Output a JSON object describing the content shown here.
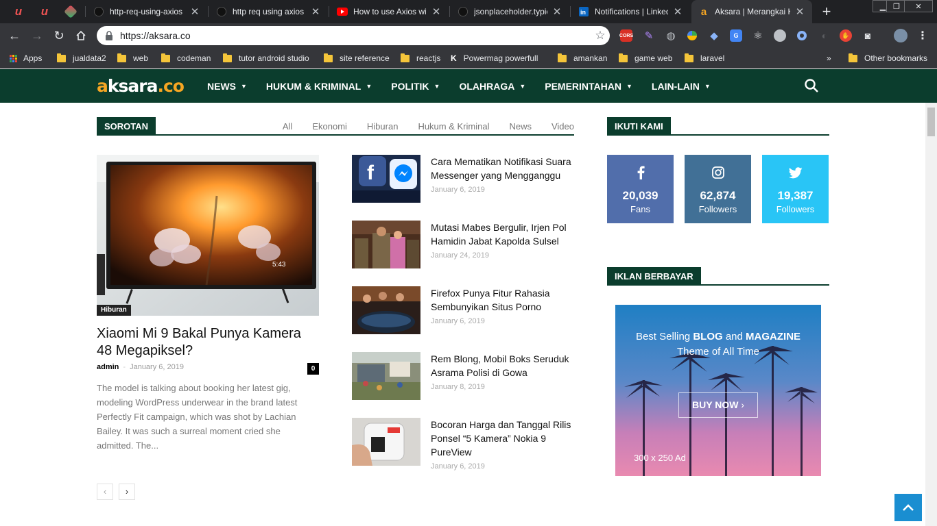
{
  "browser": {
    "tabs": [
      {
        "title": "http-req-using-axios",
        "icon": "github-icon"
      },
      {
        "title": "http req using axios",
        "icon": "github-icon"
      },
      {
        "title": "How to use Axios wit",
        "icon": "youtube-icon"
      },
      {
        "title": "jsonplaceholder.typic",
        "icon": "github-icon"
      },
      {
        "title": "Notifications | Linked",
        "icon": "linkedin-icon"
      },
      {
        "title": "Aksara | Merangkai K",
        "icon": "aksara-icon"
      }
    ],
    "url": "https://aksara.co",
    "bookmarks": [
      "Apps",
      "jualdata2",
      "web",
      "codeman",
      "tutor android studio",
      "site reference",
      "reactjs",
      "Powermag powerfull",
      "amankan",
      "game web",
      "laravel",
      "Other bookmarks"
    ],
    "overflow_label": "»",
    "extension_cors_label": "CORS"
  },
  "site": {
    "logo": {
      "part1": "a",
      "part2": "ksara",
      "part3": ".co"
    },
    "nav": [
      "NEWS",
      "HUKUM & KRIMINAL",
      "POLITIK",
      "OLAHRAGA",
      "PEMERINTAHAN",
      "LAIN-LAIN"
    ]
  },
  "sorotan": {
    "title": "SOROTAN",
    "filters": [
      "All",
      "Ekonomi",
      "Hiburan",
      "Hukum & Kriminal",
      "News",
      "Video"
    ],
    "featured": {
      "category": "Hiburan",
      "title": "Xiaomi Mi 9 Bakal Punya Kamera 48 Megapiksel?",
      "author": "admin",
      "separator": "-",
      "date": "January 6, 2019",
      "comments": "0",
      "excerpt": "The model is talking about booking her latest gig, modeling WordPress underwear in the brand latest Perfectly Fit campaign, which was shot by Lachian Bailey. It was such a surreal moment cried she admitted. The...",
      "screen_time": "5:43"
    },
    "posts": [
      {
        "title": "Cara Mematikan Notifikasi Suara Messenger yang Mengganggu",
        "date": "January 6, 2019"
      },
      {
        "title": "Mutasi Mabes Bergulir, Irjen Pol Hamidin Jabat Kapolda Sulsel",
        "date": "January 24, 2019"
      },
      {
        "title": "Firefox Punya Fitur Rahasia Sembunyikan Situs Porno",
        "date": "January 6, 2019"
      },
      {
        "title": "Rem Blong, Mobil Boks Seruduk Asrama Polisi di Gowa",
        "date": "January 8, 2019"
      },
      {
        "title": "Bocoran Harga dan Tanggal Rilis Ponsel “5 Kamera” Nokia 9 PureView",
        "date": "January 6, 2019"
      }
    ],
    "pager": {
      "prev": "‹",
      "next": "›"
    }
  },
  "follow": {
    "title": "IKUTI KAMI",
    "items": [
      {
        "network": "facebook",
        "count": "20,039",
        "label": "Fans",
        "color": "#516eab"
      },
      {
        "network": "instagram",
        "count": "62,874",
        "label": "Followers",
        "color": "#417096"
      },
      {
        "network": "twitter",
        "count": "19,387",
        "label": "Followers",
        "color": "#29c5f6"
      }
    ]
  },
  "ads": {
    "title": "IKLAN BERBAYAR",
    "headline_a": "Best Selling ",
    "headline_b": "BLOG",
    "headline_c": " and ",
    "headline_d": "MAGAZINE",
    "headline_line2": "Theme of All Time",
    "button": "BUY NOW",
    "size_label": "300 x 250 Ad"
  },
  "colors": {
    "header_green": "#0b3d2d",
    "logo_orange": "#f6a623",
    "to_top_blue": "#1a8ed1"
  }
}
